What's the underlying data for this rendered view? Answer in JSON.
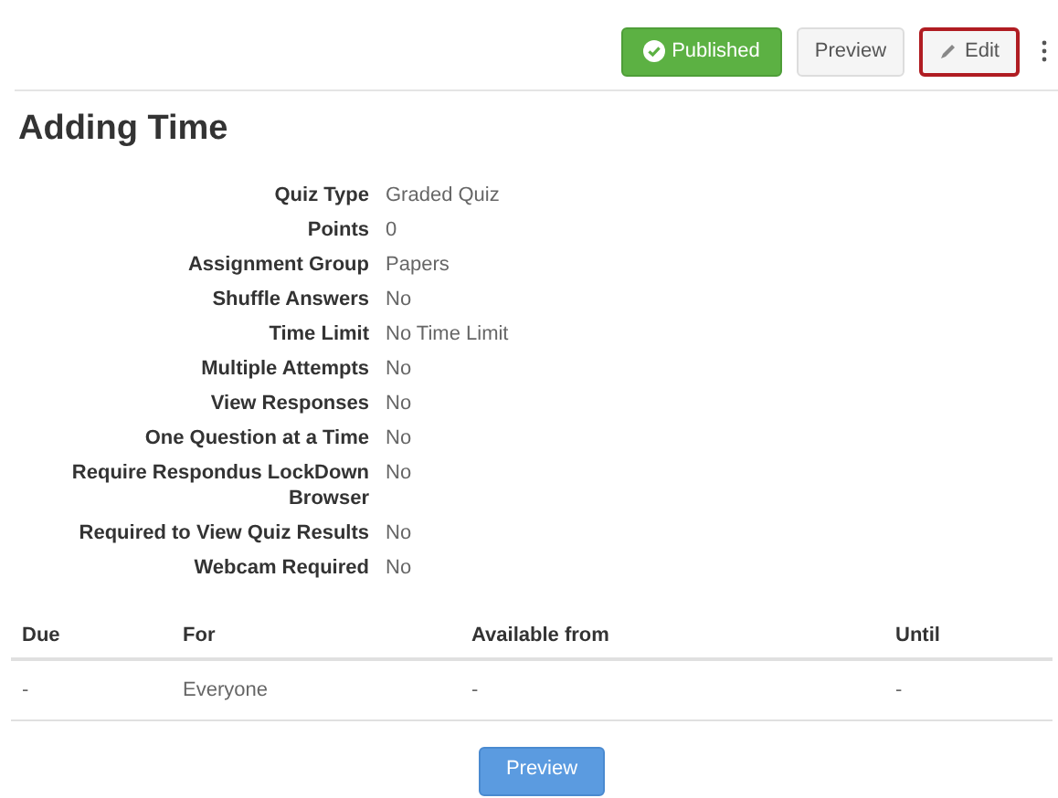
{
  "toolbar": {
    "buttons": [
      {
        "kind": "published",
        "label": "Published",
        "highlighted": false
      },
      {
        "kind": "plain",
        "label": "Preview",
        "highlighted": false
      },
      {
        "kind": "edit",
        "label": "Edit",
        "highlighted": true
      },
      {
        "kind": "more",
        "highlighted": false
      }
    ]
  },
  "title": "Adding Time",
  "details": [
    {
      "label": "Quiz Type",
      "value": "Graded Quiz"
    },
    {
      "label": "Points",
      "value": "0"
    },
    {
      "label": "Assignment Group",
      "value": "Papers"
    },
    {
      "label": "Shuffle Answers",
      "value": "No"
    },
    {
      "label": "Time Limit",
      "value": "No Time Limit"
    },
    {
      "label": "Multiple Attempts",
      "value": "No"
    },
    {
      "label": "View Responses",
      "value": "No"
    },
    {
      "label": "One Question at a Time",
      "value": "No"
    },
    {
      "label": "Require Respondus LockDown Browser",
      "value": "No"
    },
    {
      "label": "Required to View Quiz Results",
      "value": "No"
    },
    {
      "label": "Webcam Required",
      "value": "No"
    }
  ],
  "table": {
    "columns": [
      "Due",
      "For",
      "Available from",
      "Until"
    ],
    "rows": [
      [
        "-",
        "Everyone",
        "-",
        "-"
      ]
    ]
  },
  "preview_button": "Preview"
}
